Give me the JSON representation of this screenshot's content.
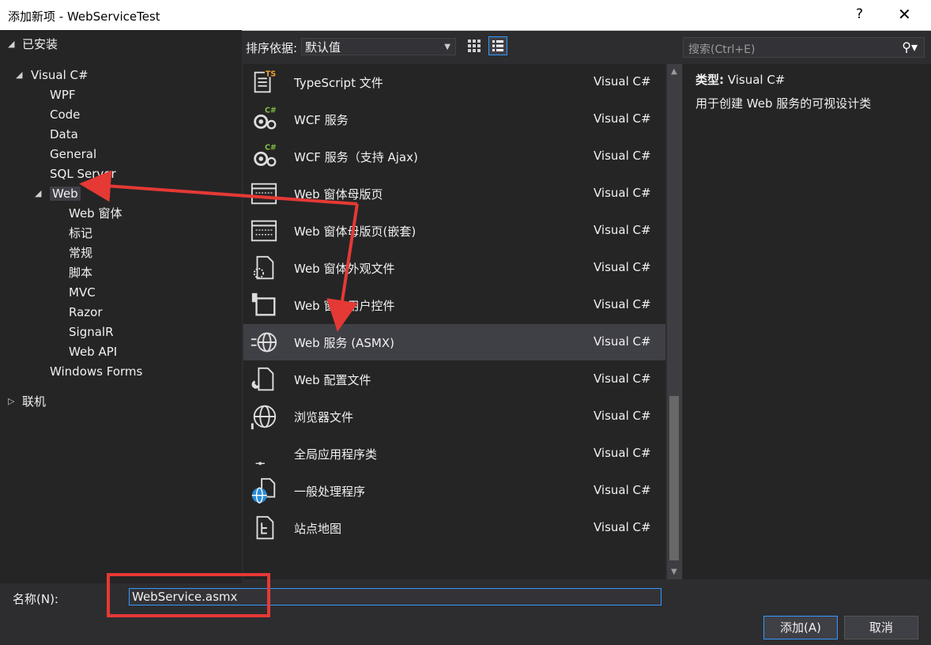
{
  "window": {
    "title": "添加新项 - WebServiceTest",
    "help": "?",
    "close": "✕"
  },
  "tree": {
    "installed": "已安装",
    "visual_csharp": "Visual C#",
    "items": [
      "WPF",
      "Code",
      "Data",
      "General",
      "SQL Server"
    ],
    "web": "Web",
    "web_children": [
      "Web 窗体",
      "标记",
      "常规",
      "脚本",
      "MVC",
      "Razor",
      "SignalR",
      "Web API"
    ],
    "windows_forms": "Windows Forms",
    "online": "联机"
  },
  "toolbar": {
    "sort_label": "排序依据:",
    "sort_value": "默认值"
  },
  "templates": [
    {
      "name": "TypeScript 文件",
      "lang": "Visual C#",
      "icon": "typescript-file-icon"
    },
    {
      "name": "WCF 服务",
      "lang": "Visual C#",
      "icon": "wcf-service-icon"
    },
    {
      "name": "WCF 服务（支持 Ajax)",
      "lang": "Visual C#",
      "icon": "wcf-ajax-service-icon"
    },
    {
      "name": "Web 窗体母版页",
      "lang": "Visual C#",
      "icon": "master-page-icon"
    },
    {
      "name": "Web 窗体母版页(嵌套)",
      "lang": "Visual C#",
      "icon": "nested-master-page-icon"
    },
    {
      "name": "Web 窗体外观文件",
      "lang": "Visual C#",
      "icon": "skin-file-icon"
    },
    {
      "name": "Web 窗体用户控件",
      "lang": "Visual C#",
      "icon": "user-control-icon"
    },
    {
      "name": "Web 服务 (ASMX)",
      "lang": "Visual C#",
      "icon": "web-service-icon"
    },
    {
      "name": "Web 配置文件",
      "lang": "Visual C#",
      "icon": "web-config-icon"
    },
    {
      "name": "浏览器文件",
      "lang": "Visual C#",
      "icon": "browser-file-icon"
    },
    {
      "name": "全局应用程序类",
      "lang": "Visual C#",
      "icon": "global-asax-icon"
    },
    {
      "name": "一般处理程序",
      "lang": "Visual C#",
      "icon": "generic-handler-icon"
    },
    {
      "name": "站点地图",
      "lang": "Visual C#",
      "icon": "sitemap-icon"
    }
  ],
  "selected_index": 7,
  "search": {
    "placeholder": "搜索(Ctrl+E)"
  },
  "details": {
    "type_label": "类型:",
    "type_value": "Visual C#",
    "description": "用于创建 Web 服务的可视设计类"
  },
  "name_field": {
    "label": "名称(N):",
    "value": "WebService.asmx"
  },
  "buttons": {
    "add": "添加(A)",
    "cancel": "取消"
  },
  "colors": {
    "accent": "#3399ff",
    "annotation": "#e53935",
    "background": "#2d2d30"
  }
}
